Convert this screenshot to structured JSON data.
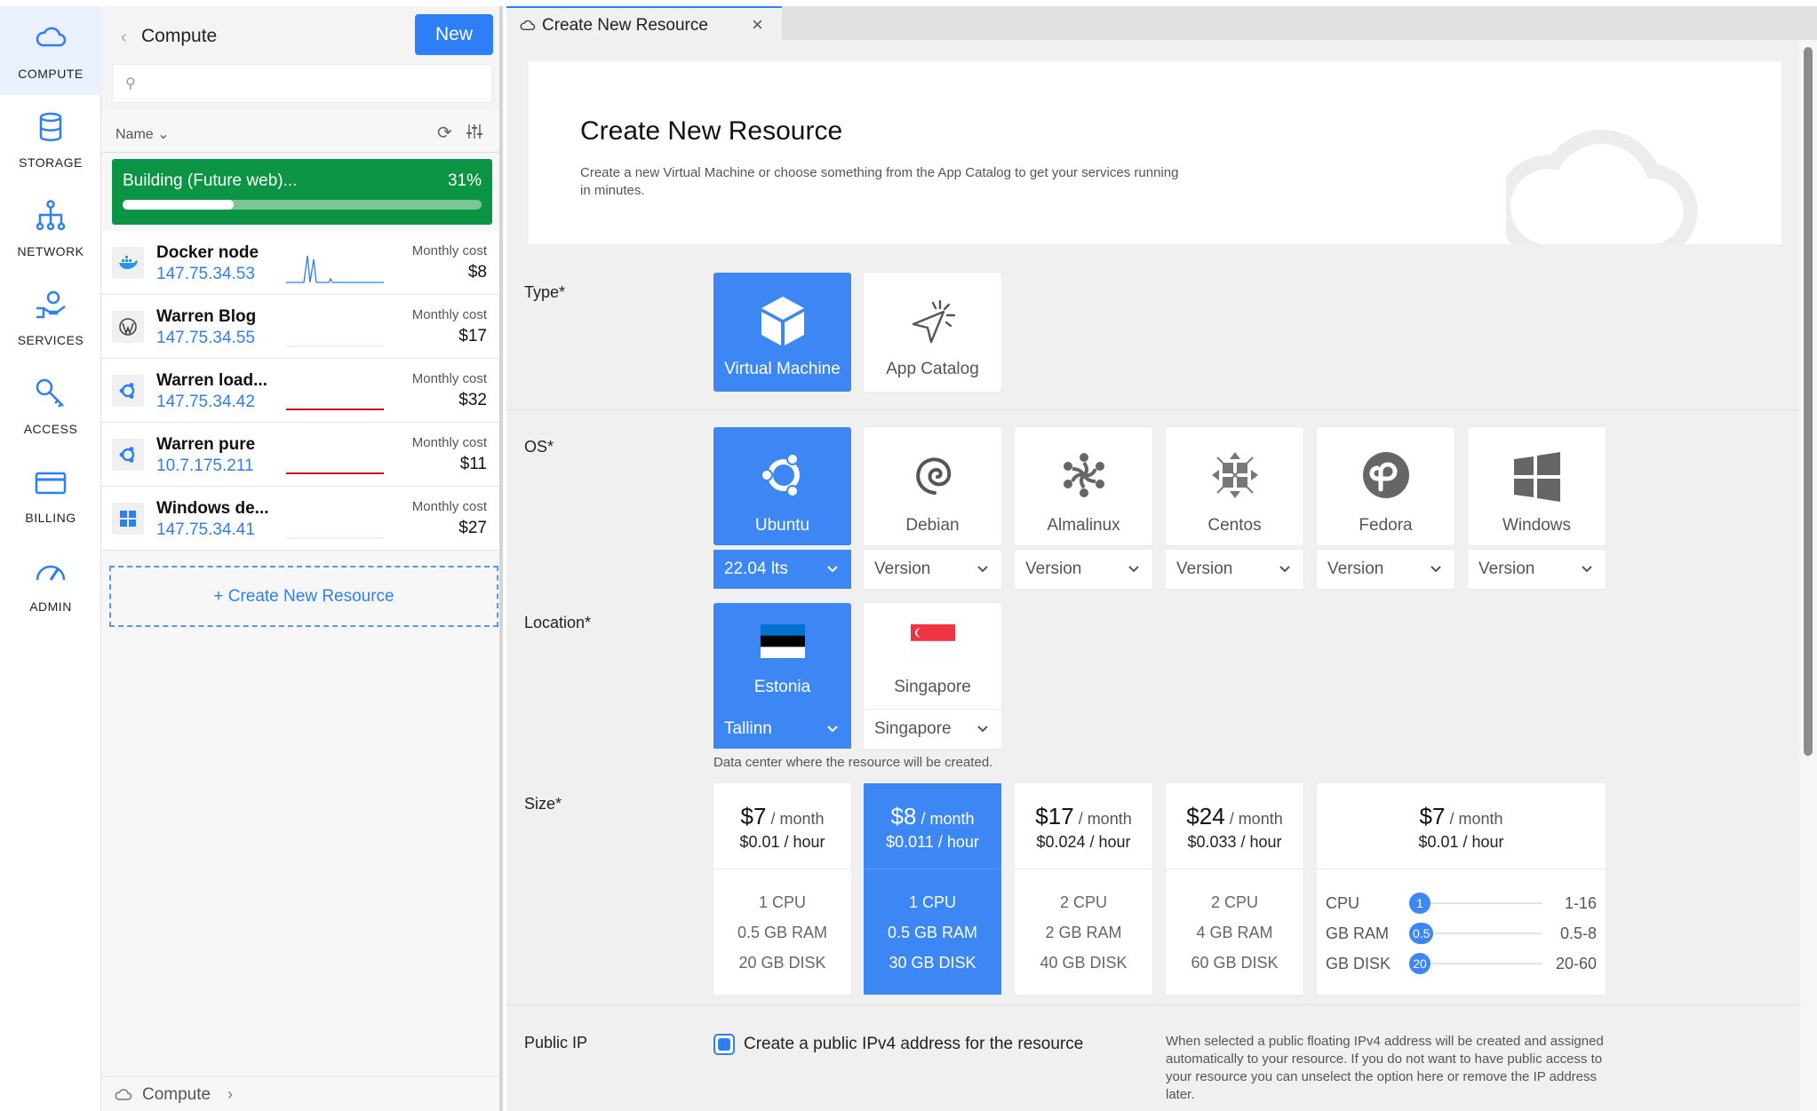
{
  "rail": {
    "items": [
      {
        "label": "COMPUTE",
        "icon": "cloud-icon"
      },
      {
        "label": "STORAGE",
        "icon": "database-icon"
      },
      {
        "label": "NETWORK",
        "icon": "network-icon"
      },
      {
        "label": "SERVICES",
        "icon": "services-icon"
      },
      {
        "label": "ACCESS",
        "icon": "key-icon"
      },
      {
        "label": "BILLING",
        "icon": "credit-card-icon"
      },
      {
        "label": "ADMIN",
        "icon": "gauge-icon"
      }
    ],
    "accent": "#2d7ef7"
  },
  "list": {
    "title": "Compute",
    "new_label": "New",
    "search_placeholder": "",
    "sort_label": "Name",
    "building": {
      "name": "Building (Future web)...",
      "percent_label": "31%",
      "progress": 0.31,
      "color": "#0a9444"
    },
    "cost_label": "Monthly cost",
    "resources": [
      {
        "name": "Docker node",
        "ip": "147.75.34.53",
        "cost": "$8",
        "icon": "docker-icon"
      },
      {
        "name": "Warren Blog",
        "ip": "147.75.34.55",
        "cost": "$17",
        "icon": "wordpress-icon"
      },
      {
        "name": "Warren load...",
        "ip": "147.75.34.42",
        "cost": "$32",
        "icon": "ubuntu-icon"
      },
      {
        "name": "Warren pure",
        "ip": "10.7.175.211",
        "cost": "$11",
        "icon": "ubuntu-icon"
      },
      {
        "name": "Windows de...",
        "ip": "147.75.34.41",
        "cost": "$27",
        "icon": "windows-icon"
      }
    ],
    "create_label": "+ Create New Resource",
    "footer_label": "Compute"
  },
  "tab": {
    "label": "Create New Resource"
  },
  "hero": {
    "title": "Create New Resource",
    "description": "Create a new Virtual Machine or choose something from the App Catalog to get your services running in minutes."
  },
  "form": {
    "type_label": "Type*",
    "types": [
      "Virtual Machine",
      "App Catalog"
    ],
    "os_label": "OS*",
    "os": [
      {
        "name": "Ubuntu",
        "version": "22.04 lts"
      },
      {
        "name": "Debian",
        "version": "Version"
      },
      {
        "name": "Almalinux",
        "version": "Version"
      },
      {
        "name": "Centos",
        "version": "Version"
      },
      {
        "name": "Fedora",
        "version": "Version"
      },
      {
        "name": "Windows",
        "version": "Version"
      }
    ],
    "location_label": "Location*",
    "locations": [
      {
        "name": "Estonia",
        "city": "Tallinn"
      },
      {
        "name": "Singapore",
        "city": "Singapore"
      }
    ],
    "location_note": "Data center where the resource will be created.",
    "size_label": "Size*",
    "per_month": "/ month",
    "sizes": [
      {
        "month": "$7",
        "hour": "$0.01 / hour",
        "cpu": "1 CPU",
        "ram": "0.5 GB RAM",
        "disk": "20 GB DISK"
      },
      {
        "month": "$8",
        "hour": "$0.011 / hour",
        "cpu": "1 CPU",
        "ram": "0.5 GB RAM",
        "disk": "30 GB DISK"
      },
      {
        "month": "$17",
        "hour": "$0.024 / hour",
        "cpu": "2 CPU",
        "ram": "2 GB RAM",
        "disk": "40 GB DISK"
      },
      {
        "month": "$24",
        "hour": "$0.033 / hour",
        "cpu": "2 CPU",
        "ram": "4 GB RAM",
        "disk": "60 GB DISK"
      }
    ],
    "custom": {
      "month": "$7",
      "hour": "$0.01 / hour",
      "sliders": [
        {
          "name": "CPU",
          "value": "1",
          "range": "1-16",
          "fraction": 0.0
        },
        {
          "name": "GB RAM",
          "value": "0.5",
          "range": "0.5-8",
          "fraction": 0.0
        },
        {
          "name": "GB DISK",
          "value": "20",
          "range": "20-60",
          "fraction": 0.0
        }
      ]
    },
    "ip_section_label": "Public IP",
    "ip_checkbox_label": "Create a public IPv4 address for the resource",
    "ip_checked": true,
    "ip_note": "When selected a public floating IPv4 address will be created and assigned automatically to your resource. If you do not want to have public access to your resource you can unselect the option here or remove the IP address later."
  }
}
